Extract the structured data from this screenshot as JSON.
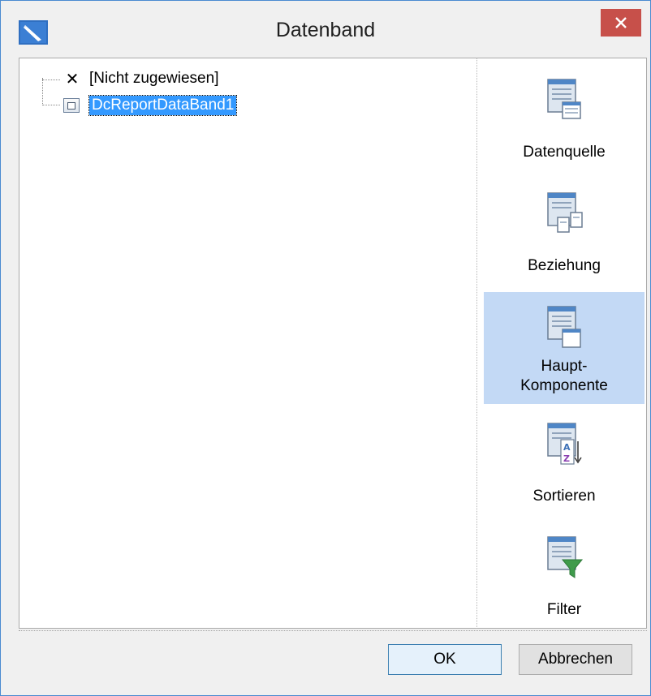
{
  "window": {
    "title": "Datenband",
    "close_glyph": "✕",
    "icon": "report-pen-icon"
  },
  "tree": {
    "items": [
      {
        "label": "[Nicht zugewiesen]",
        "icon": "x-mark-icon",
        "selected": false
      },
      {
        "label": "DcReportDataBand1",
        "icon": "data-band-icon",
        "selected": true
      }
    ]
  },
  "side_buttons": [
    {
      "label": "Datenquelle",
      "icon": "data-source-icon",
      "active": false
    },
    {
      "label": "Beziehung",
      "icon": "relation-icon",
      "active": false
    },
    {
      "label_line1": "Haupt-",
      "label_line2": "Komponente",
      "icon": "master-component-icon",
      "active": true
    },
    {
      "label": "Sortieren",
      "icon": "sort-az-icon",
      "active": false
    },
    {
      "label": "Filter",
      "icon": "filter-funnel-icon",
      "active": false
    }
  ],
  "footer": {
    "ok_label": "OK",
    "cancel_label": "Abbrechen"
  },
  "colors": {
    "accent_selected": "#3399ff",
    "side_active": "#c3d9f5",
    "close_button": "#c7504a"
  }
}
